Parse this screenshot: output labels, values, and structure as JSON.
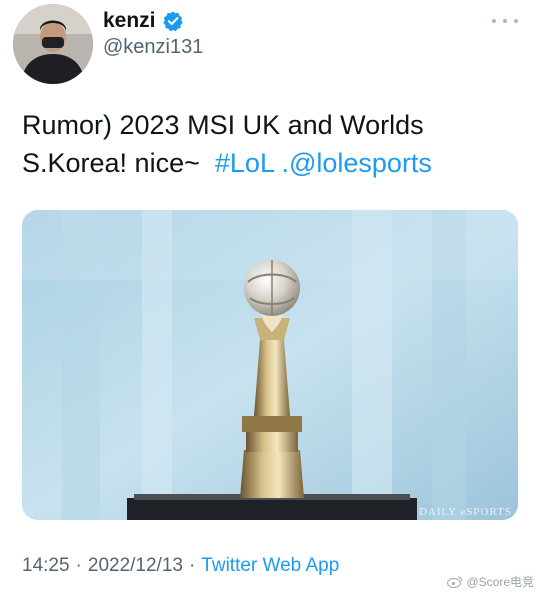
{
  "author": {
    "display_name": "kenzi",
    "handle": "@kenzi131",
    "verified": true
  },
  "tweet": {
    "line1": "Rumor) 2023 MSI UK and Worlds",
    "line2_prefix": "S.Korea! nice~",
    "hashtag": "#LoL",
    "mention": ".@lolesports"
  },
  "media": {
    "watermark": "DAILY eSPORTS",
    "subject": "trophy"
  },
  "meta": {
    "time": "14:25",
    "separator": "·",
    "date": "2022/12/13",
    "source": "Twitter Web App"
  },
  "watermark_overlay": "@Score电竞",
  "colors": {
    "link": "#1d9bf0",
    "secondary_text": "#536471",
    "primary_text": "#0f1419"
  },
  "icons": [
    "verified-badge-icon",
    "more-options-icon",
    "weibo-logo-icon"
  ]
}
